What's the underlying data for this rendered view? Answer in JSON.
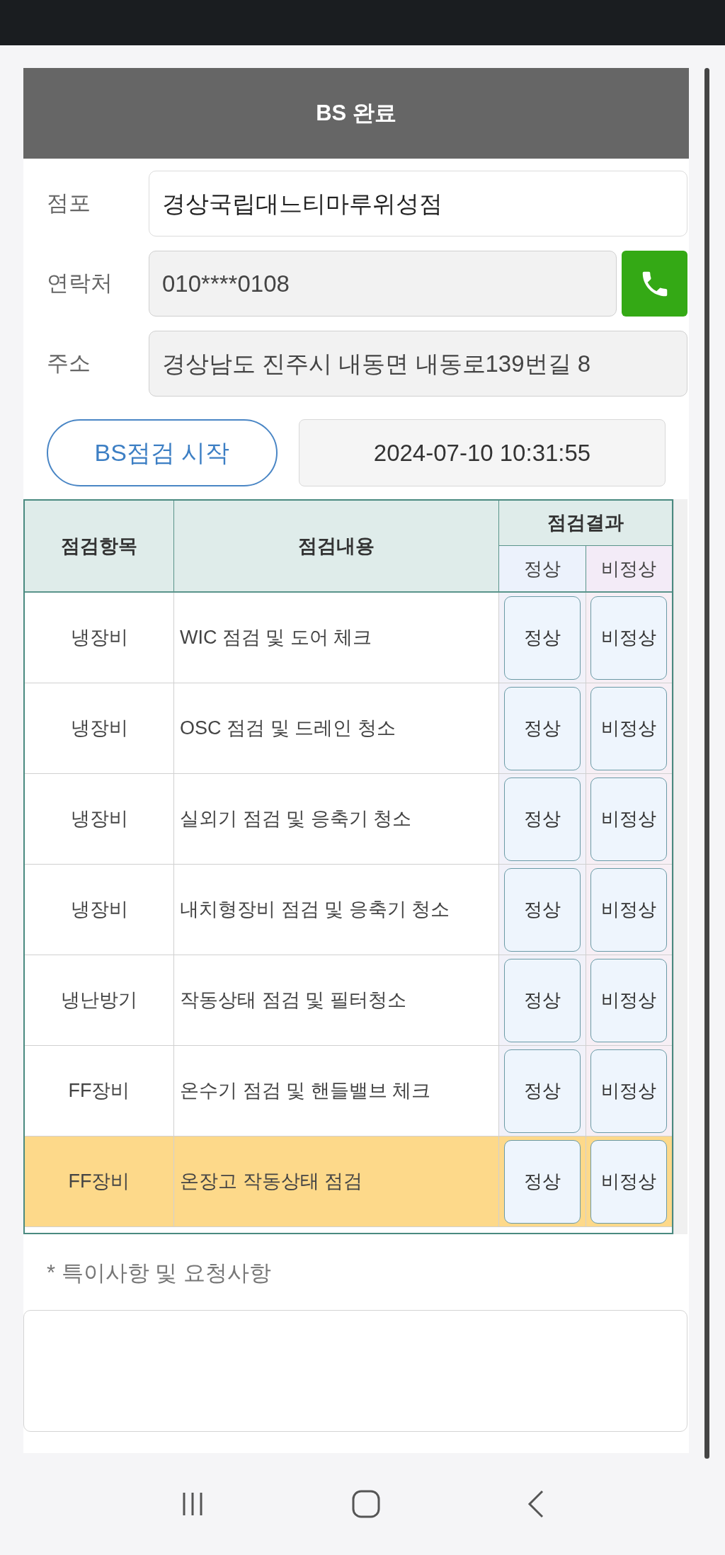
{
  "dialog": {
    "title": "BS 완료"
  },
  "fields": [
    {
      "label": "점포",
      "value": "경상국립대느티마루위성점",
      "readonly": false
    },
    {
      "label": "연락처",
      "value": "010****0108",
      "readonly": true,
      "call_button": true
    },
    {
      "label": "주소",
      "value": "경상남도 진주시 내동면 내동로139번길 8",
      "readonly": true
    }
  ],
  "start_button": "BS점검 시작",
  "start_time": "2024-07-10 10:31:55",
  "table": {
    "columns": [
      "점검항목",
      "점검내용"
    ],
    "result_header": "점검결과",
    "result_columns": [
      "정상",
      "비정상"
    ],
    "rows": [
      {
        "item": "냉장비",
        "content": "WIC 점검 및 도어 체크",
        "buttons": [
          "정상",
          "비정상"
        ],
        "highlighted": false
      },
      {
        "item": "냉장비",
        "content": "OSC 점검 및 드레인 청소",
        "buttons": [
          "정상",
          "비정상"
        ],
        "highlighted": false
      },
      {
        "item": "냉장비",
        "content": "실외기 점검 및 응축기 청소",
        "buttons": [
          "정상",
          "비정상"
        ],
        "highlighted": false
      },
      {
        "item": "냉장비",
        "content": "내치형장비 점검 및 응축기 청소",
        "buttons": [
          "정상",
          "비정상"
        ],
        "highlighted": false
      },
      {
        "item": "냉난방기",
        "content": "작동상태 점검 및 필터청소",
        "buttons": [
          "정상",
          "비정상"
        ],
        "highlighted": false
      },
      {
        "item": "FF장비",
        "content": "온수기 점검 및 핸들밸브 체크",
        "buttons": [
          "정상",
          "비정상"
        ],
        "highlighted": false
      },
      {
        "item": "FF장비",
        "content": "온장고 작동상태 점검",
        "buttons": [
          "정상",
          "비정상"
        ],
        "highlighted": true
      }
    ]
  },
  "notes": {
    "label": "* 특이사항 및 요청사항"
  }
}
